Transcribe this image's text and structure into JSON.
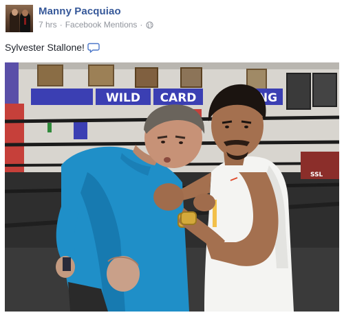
{
  "post": {
    "author": "Manny Pacquiao",
    "time": "7 hrs",
    "separator": "·",
    "source": "Facebook Mentions",
    "privacy_icon": "globe-icon",
    "text": "Sylvester Stallone!",
    "text_emoji_icon": "speech-bubble-icon"
  },
  "photo": {
    "banner_left": "WILD",
    "banner_middle": "CARD",
    "banner_right": "NG",
    "ring_corner_label": "SSL"
  },
  "colors": {
    "author_link": "#365899",
    "meta_gray": "#90949c",
    "banner_blue": "#3b3fb3",
    "ring_red": "#c6403a",
    "shirt_blue": "#1f8fc8"
  }
}
